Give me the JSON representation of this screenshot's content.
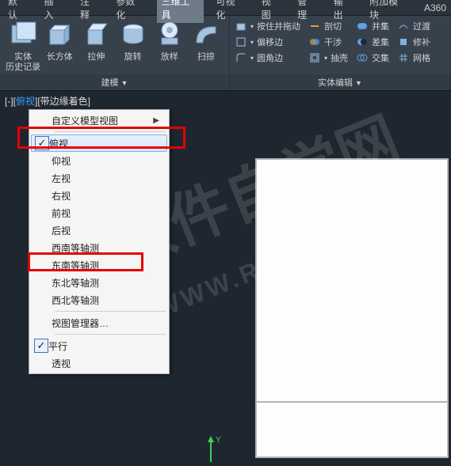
{
  "tabs": [
    "默认",
    "插入",
    "注释",
    "参数化",
    "三维工具",
    "可视化",
    "视图",
    "管理",
    "输出",
    "附加模块",
    "A360"
  ],
  "ribbon": {
    "group1": {
      "label": "建模",
      "buttons": [
        "实体\n历史记录",
        "长方体",
        "拉伸",
        "旋转",
        "放样",
        "扫掠"
      ]
    },
    "group2": {
      "label": "实体编辑",
      "rows": [
        [
          "按住并拖动",
          "剖切",
          "并集",
          "过渡"
        ],
        [
          "偏移边",
          "干涉",
          "差集",
          "修补"
        ],
        [
          "圆角边",
          "抽壳",
          "交集",
          "网格"
        ]
      ]
    }
  },
  "viewinfo": {
    "pre": "[-][",
    "hl": "俯视",
    "post": "][带边缘着色]"
  },
  "menu": {
    "header": "自定义模型视图",
    "items": [
      "俯视",
      "仰视",
      "左视",
      "右视",
      "前视",
      "后视",
      "西南等轴测",
      "东南等轴测",
      "东北等轴测",
      "西北等轴测"
    ],
    "manager": "视图管理器…",
    "parallel": "平行",
    "perspective": "透视"
  },
  "watermark": {
    "line1": "软件自学网",
    "line2": "WWW.RJZXW.COM"
  }
}
